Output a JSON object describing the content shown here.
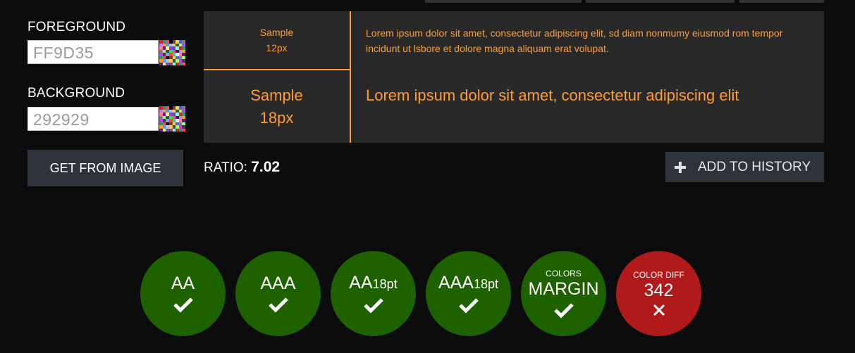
{
  "foreground": {
    "label": "FOREGROUND",
    "value": "FF9D35",
    "color": "#ff9d35"
  },
  "background": {
    "label": "BACKGROUND",
    "value": "292929",
    "color": "#292929"
  },
  "get_from_image_label": "GET FROM IMAGE",
  "ratio": {
    "label": "RATIO:",
    "value": "7.02"
  },
  "add_to_history_label": "ADD TO HISTORY",
  "preview": {
    "small_sample": [
      "Sample",
      "12px"
    ],
    "small_text": "Lorem ipsum dolor sit amet, consectetur adipiscing elit, sd diam nonmumy eiusmod rom tempor incidunt ut lsbore et dolore magna aliquam erat volupat.",
    "large_sample": [
      "Sample",
      "18px"
    ],
    "large_text": "Lorem ipsum dolor sit amet, consectetur adipiscing elit"
  },
  "results": [
    {
      "main": "AA",
      "status": "pass"
    },
    {
      "main": "AAA",
      "status": "pass"
    },
    {
      "main": "AA",
      "sub": "18pt",
      "status": "pass"
    },
    {
      "main": "AAA",
      "sub": "18pt",
      "status": "pass"
    },
    {
      "top": "COLORS",
      "main": "MARGIN",
      "status": "pass"
    },
    {
      "top": "COLOR DIFF",
      "main": "342",
      "status": "fail"
    }
  ],
  "colors": {
    "pass": "#1e6200",
    "fail": "#b11a1a",
    "accent": "#ff9d35",
    "button": "#2f333a"
  }
}
